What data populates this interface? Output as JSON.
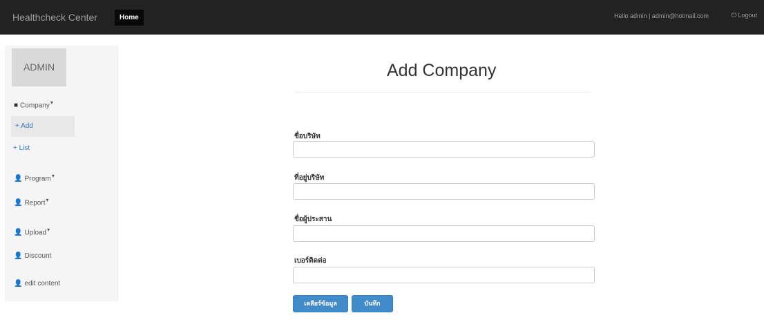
{
  "navbar": {
    "brand": "Healthcheck Center",
    "home": "Home",
    "user": "Hello admin | admin@hotmail.com",
    "logout": "Logout"
  },
  "sidebar": {
    "header": "ADMIN",
    "items": [
      {
        "label": "Company",
        "icon": "square-icon"
      },
      {
        "label": "+ Add"
      },
      {
        "label": "+ List"
      },
      {
        "label": "Program",
        "icon": "user-icon"
      },
      {
        "label": "Report",
        "icon": "user-icon"
      },
      {
        "label": "Upload",
        "icon": "user-icon"
      },
      {
        "label": "Discount",
        "icon": "user-icon"
      },
      {
        "label": "edit content",
        "icon": "user-icon"
      }
    ]
  },
  "main": {
    "title": "Add Company",
    "fields": [
      {
        "label": "ชื่อบริษัท",
        "value": ""
      },
      {
        "label": "ที่อยู่บริษัท",
        "value": ""
      },
      {
        "label": "ชื่อผู้ประสาน",
        "value": ""
      },
      {
        "label": "เบอร์ติดต่อ",
        "value": ""
      }
    ],
    "buttons": {
      "clear": "เคลียร์ข้อมูล",
      "save": "บันทึก"
    }
  },
  "colors": {
    "navbar": "#222222",
    "primary": "#428bca",
    "sidebar": "#f5f5f5"
  }
}
